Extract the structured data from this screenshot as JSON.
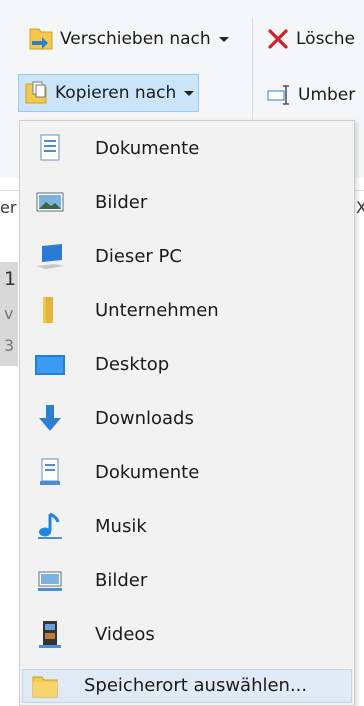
{
  "ribbon": {
    "move_to": "Verschieben nach",
    "copy_to": "Kopieren nach",
    "delete": "Lösche",
    "rename": "Umber"
  },
  "background": {
    "frag1": "er",
    "frag2": "1",
    "frag3": "v",
    "frag4": "3",
    "close": "X"
  },
  "menu": {
    "items": [
      {
        "label": "Dokumente",
        "icon": "documents-icon"
      },
      {
        "label": "Bilder",
        "icon": "pictures-icon"
      },
      {
        "label": "Dieser PC",
        "icon": "this-pc-icon"
      },
      {
        "label": "Unternehmen",
        "icon": "folder-icon"
      },
      {
        "label": "Desktop",
        "icon": "desktop-icon"
      },
      {
        "label": "Downloads",
        "icon": "downloads-icon"
      },
      {
        "label": "Dokumente",
        "icon": "documents-library-icon"
      },
      {
        "label": "Musik",
        "icon": "music-icon"
      },
      {
        "label": "Bilder",
        "icon": "pictures-library-icon"
      },
      {
        "label": "Videos",
        "icon": "videos-icon"
      }
    ],
    "choose_location": "Speicherort auswählen..."
  }
}
